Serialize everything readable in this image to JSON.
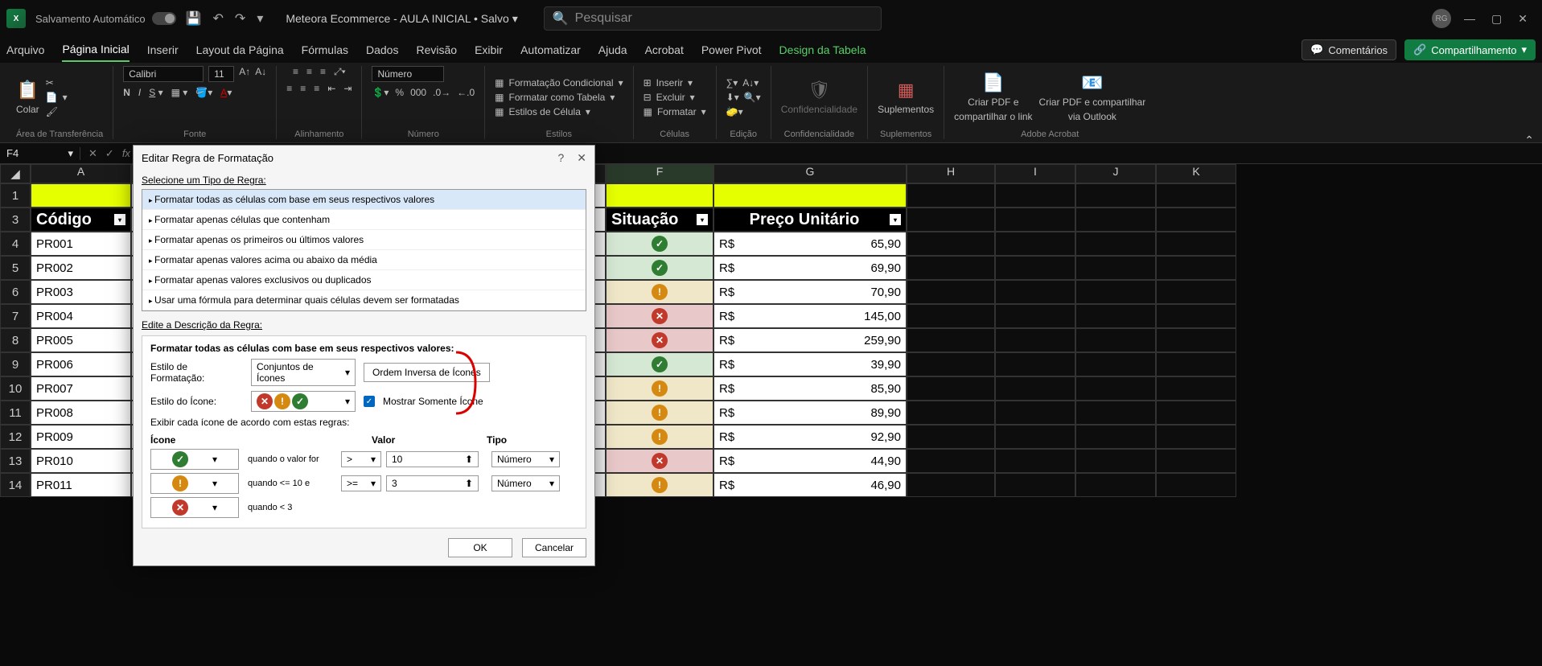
{
  "titleBar": {
    "appInitials": "X",
    "autosave": "Salvamento Automático",
    "docTitle": "Meteora Ecommerce - AULA INICIAL • Salvo",
    "searchPlaceholder": "Pesquisar",
    "avatar": "RG"
  },
  "ribbonTabs": {
    "tabs": [
      "Arquivo",
      "Página Inicial",
      "Inserir",
      "Layout da Página",
      "Fórmulas",
      "Dados",
      "Revisão",
      "Exibir",
      "Automatizar",
      "Ajuda",
      "Acrobat",
      "Power Pivot",
      "Design da Tabela"
    ],
    "comments": "Comentários",
    "share": "Compartilhamento"
  },
  "ribbonGroups": {
    "clipboard": {
      "paste": "Colar",
      "label": "Área de Transferência"
    },
    "font": {
      "name": "Calibri",
      "size": "11",
      "label": "Fonte"
    },
    "alignment": {
      "label": "Alinhamento"
    },
    "number": {
      "format": "Número",
      "label": "Número"
    },
    "styles": {
      "cond": "Formatação Condicional",
      "table": "Formatar como Tabela",
      "cell": "Estilos de Célula",
      "label": "Estilos"
    },
    "cells": {
      "insert": "Inserir",
      "delete": "Excluir",
      "format": "Formatar",
      "label": "Células"
    },
    "editing": {
      "label": "Edição"
    },
    "conf": {
      "btn": "Confidencialidade",
      "label": "Confidencialidade"
    },
    "addins": {
      "btn": "Suplementos",
      "label": "Suplementos"
    },
    "adobe": {
      "pdf1a": "Criar PDF e",
      "pdf1b": "compartilhar o link",
      "pdf2a": "Criar PDF e compartilhar",
      "pdf2b": "via Outlook",
      "label": "Adobe Acrobat"
    }
  },
  "formulaBar": {
    "cellRef": "F4"
  },
  "columns": [
    "A",
    "F",
    "G",
    "H",
    "I",
    "J",
    "K"
  ],
  "rowNumbers": [
    "1",
    "3",
    "4",
    "5",
    "6",
    "7",
    "8",
    "9",
    "10",
    "11",
    "12",
    "13",
    "14"
  ],
  "tableHeaders": {
    "codigo": "Código",
    "situacao": "Situação",
    "preco": "Preço Unitário"
  },
  "rows": [
    {
      "code": "PR001",
      "status": "green",
      "currency": "R$",
      "price": "65,90"
    },
    {
      "code": "PR002",
      "status": "green",
      "currency": "R$",
      "price": "69,90"
    },
    {
      "code": "PR003",
      "status": "amber",
      "currency": "R$",
      "price": "70,90"
    },
    {
      "code": "PR004",
      "status": "red",
      "currency": "R$",
      "price": "145,00"
    },
    {
      "code": "PR005",
      "status": "red",
      "currency": "R$",
      "price": "259,90"
    },
    {
      "code": "PR006",
      "status": "green",
      "currency": "R$",
      "price": "39,90"
    },
    {
      "code": "PR007",
      "status": "amber",
      "currency": "R$",
      "price": "85,90"
    },
    {
      "code": "PR008",
      "status": "amber",
      "currency": "R$",
      "price": "89,90"
    },
    {
      "code": "PR009",
      "status": "amber",
      "currency": "R$",
      "price": "92,90"
    },
    {
      "code": "PR010",
      "status": "red",
      "currency": "R$",
      "price": "44,90"
    },
    {
      "code": "PR011",
      "status": "amber",
      "currency": "R$",
      "price": "46,90"
    }
  ],
  "dialog": {
    "title": "Editar Regra de Formatação",
    "selectRuleLabel": "Selecione um Tipo de Regra:",
    "ruleTypes": [
      "Formatar todas as células com base em seus respectivos valores",
      "Formatar apenas células que contenham",
      "Formatar apenas os primeiros ou últimos valores",
      "Formatar apenas valores acima ou abaixo da média",
      "Formatar apenas valores exclusivos ou duplicados",
      "Usar uma fórmula para determinar quais células devem ser formatadas"
    ],
    "editDescLabel": "Edite a Descrição da Regra:",
    "formatAll": "Formatar todas as células com base em seus respectivos valores:",
    "styleFormatLabel": "Estilo de Formatação:",
    "styleFormatValue": "Conjuntos de Ícones",
    "reverseOrder": "Ordem Inversa de Ícones",
    "iconStyleLabel": "Estilo do Ícone:",
    "showIconOnly": "Mostrar Somente Ícone",
    "displayRulesLabel": "Exibir cada ícone de acordo com estas regras:",
    "headers": {
      "icon": "Ícone",
      "value": "Valor",
      "type": "Tipo"
    },
    "iconRules": [
      {
        "icon": "g",
        "when": "quando o valor for",
        "op": ">",
        "val": "10",
        "type": "Número"
      },
      {
        "icon": "a",
        "when": "quando <= 10 e",
        "op": ">=",
        "val": "3",
        "type": "Número"
      },
      {
        "icon": "r",
        "when": "quando < 3"
      }
    ],
    "ok": "OK",
    "cancel": "Cancelar"
  }
}
